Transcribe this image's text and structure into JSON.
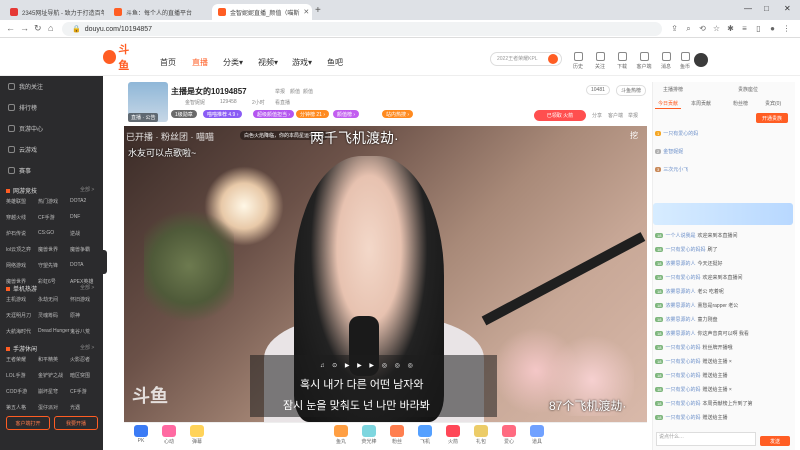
{
  "browser": {
    "tabs": [
      {
        "label": "2345网址导航 - 致力于打造百年",
        "favicon_color": "#e53935",
        "active": false
      },
      {
        "label": "斗鱼：每个人的直播平台",
        "favicon_color": "#ff5d23",
        "active": false
      },
      {
        "label": "金智妮妮直播_颜值（喵斯",
        "favicon_color": "#ff5d23",
        "active": true
      }
    ],
    "new_tab": "+",
    "url": "douyu.com/10194857",
    "win_controls": [
      "—",
      "□",
      "✕"
    ]
  },
  "site": {
    "nav": [
      "首页",
      "直播",
      "分类▾",
      "视频▾",
      "游戏▾",
      "鱼吧"
    ],
    "active_nav_index": 1,
    "search_placeholder": "2022王者荣耀KPL",
    "header_icons": [
      "历史",
      "关注",
      "下载",
      "客户端",
      "消息",
      "鱼币"
    ]
  },
  "sidebar": {
    "items": [
      {
        "label": "我的关注"
      },
      {
        "label": "排行榜"
      },
      {
        "label": "页游中心"
      },
      {
        "label": "云游戏"
      },
      {
        "label": "赛事"
      }
    ],
    "sections": [
      {
        "title": "网游竞技",
        "more": "全部 >",
        "grid": [
          "英雄联盟",
          "热门游戏",
          "DOTA2",
          "穿越火线",
          "CF手游",
          "DNF",
          "炉石传说",
          "CS:GO",
          "逆战",
          "lol云顶之弈",
          "魔兽世界",
          "魔兽争霸",
          "网络游戏",
          "守望先锋",
          "DOTA",
          "魔兽世界",
          "彩虹6号",
          "APEX英雄"
        ]
      },
      {
        "title": "单机热游",
        "more": "全部 >",
        "grid": [
          "主机游戏",
          "永劫无间",
          "怀旧游戏",
          "天涯明月刀",
          "灵魂筹码",
          "原神",
          "大航海时代",
          "Dread Hunger",
          "鬼谷八荒"
        ]
      },
      {
        "title": "手游休闲",
        "more": "全部 >",
        "grid": [
          "王者荣耀",
          "和平精英",
          "火影忍者",
          "LOL手游",
          "金铲铲之战",
          "暗区突围",
          "COD手游",
          "崩坏星穹",
          "CF手游",
          "第五人格",
          "蛋仔派对",
          "光遇"
        ]
      }
    ],
    "btn_client": "客户端打开",
    "btn_broadcast": "我要开播"
  },
  "room": {
    "title": "主播是女的10194857",
    "title_tag": "举报",
    "sub_tags": [
      "颜值",
      "颜值"
    ],
    "meta": [
      "金智妮妮",
      "129458",
      "2小时",
      "看直播"
    ],
    "pills": [
      {
        "label": "1级勋章",
        "color": "#6a6a6a"
      },
      {
        "label": "喵喵推荐 4.9 ›",
        "color": "#8a5cf5"
      },
      {
        "label": "超级颜值担当 ›",
        "color": "#b455f0"
      },
      {
        "label": "分钟榜 21 ›",
        "color": "#ff8a1f"
      },
      {
        "label": "颜值榜 ›",
        "color": "#c25df0"
      },
      {
        "label": "站内热搜 ›",
        "color": "#ff8a1f"
      }
    ],
    "online_badge": "直播 · 公告",
    "follow_btn": "已领取 火箭",
    "fans": "10481",
    "report": "斗鱼热榜",
    "ops": [
      "分享",
      "客户端",
      "举报"
    ]
  },
  "video": {
    "overlay_title": "两千飞机渡劫·",
    "danmaku_top": "白色火焰降临，你的本局星运不知晓",
    "top_left_1": "已开播 · 粉丝团 · 喵喵",
    "top_left_2": "水友可以点歌啦~",
    "corner": "挖",
    "lyric1": "혹시 내가 다른 어떤 남자와",
    "lyric2": "잠시 눈을 맞춰도 넌 나만 바라봐",
    "controls": "♫ ⊙ ▶ ▶ ▶ ◎ ◎ ◎",
    "gift_count": "87个飞机渡劫·",
    "watermark": "斗鱼"
  },
  "gifts": [
    {
      "label": "PK",
      "color": "#3b7bf5"
    },
    {
      "label": "心动",
      "color": "#ff6aa2"
    },
    {
      "label": "弹幕",
      "color": "#ffd35a"
    },
    {
      "label": "鱼丸",
      "color": "#ff9f43"
    },
    {
      "label": "荧光棒",
      "color": "#7ed6df"
    },
    {
      "label": "粉丝",
      "color": "#ff7f50"
    },
    {
      "label": "飞机",
      "color": "#54a0ff"
    },
    {
      "label": "火箭",
      "color": "#ff4757"
    },
    {
      "label": "礼包",
      "color": "#eccc68"
    },
    {
      "label": "爱心",
      "color": "#ff6b81"
    },
    {
      "label": "道具",
      "color": "#70a1ff"
    }
  ],
  "chat": {
    "tabs_top": [
      "主播排榜",
      "贵族座位"
    ],
    "tabs": [
      "今日贡献",
      "本周贡献",
      "粉丝榜",
      "贵宾(0)"
    ],
    "open_guard": "开通贵族",
    "rank_items": [
      {
        "name": "一只有爱心的妈"
      },
      {
        "name": "金智妮妮"
      },
      {
        "name": "三次元小飞"
      }
    ],
    "messages": [
      {
        "lv": "18",
        "name": "一个人说我是",
        "text": "欢迎来到本直播间"
      },
      {
        "lv": "18",
        "name": "一只有爱心的妈妈",
        "text": "刷了"
      },
      {
        "lv": "18",
        "name": "浓雾思源的人",
        "text": "今天还挺好"
      },
      {
        "lv": "18",
        "name": "一只有爱心的妈",
        "text": "欢迎来到本直播间"
      },
      {
        "lv": "18",
        "name": "浓雾思源的人",
        "text": "老公   吃着呢"
      },
      {
        "lv": "18",
        "name": "浓雾思源的人",
        "text": "熏愁是rapper   老公"
      },
      {
        "lv": "18",
        "name": "浓雾思源的人",
        "text": "童力刚盘"
      },
      {
        "lv": "18",
        "name": "浓雾思源的人",
        "text": "你这声音真可以啊 我看"
      },
      {
        "lv": "18",
        "name": "一只有爱心的妈",
        "text": "粉丝牌开播哦"
      },
      {
        "lv": "18",
        "name": "一只有爱心的妈",
        "text": "赠送给主播 ×"
      },
      {
        "lv": "18",
        "name": "一只有爱心的妈",
        "text": "赠送给主播"
      },
      {
        "lv": "18",
        "name": "一只有爱心的妈",
        "text": "赠送给主播 ×"
      },
      {
        "lv": "18",
        "name": "一只有爱心的妈",
        "text": "本周贡献榜上升到了第"
      },
      {
        "lv": "18",
        "name": "一只有爱心的妈",
        "text": "赠送给主播"
      }
    ],
    "input_placeholder": "说点什么…",
    "send": "发送"
  }
}
